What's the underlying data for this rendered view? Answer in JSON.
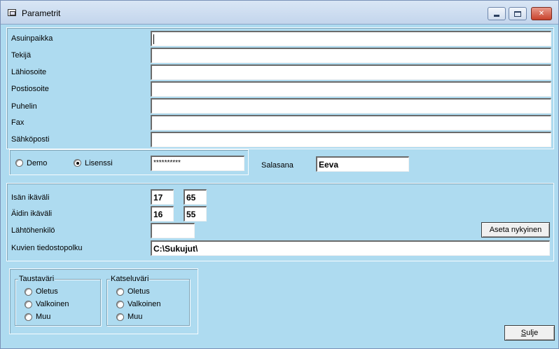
{
  "window": {
    "title": "Parametrit",
    "minimize_icon": "minimize-icon",
    "maximize_icon": "maximize-icon",
    "close_icon": "close-icon",
    "close_glyph": "✕"
  },
  "contact": {
    "fields": [
      {
        "label": "Asuinpaikka",
        "value": ""
      },
      {
        "label": "Tekijä",
        "value": ""
      },
      {
        "label": "Lähiosoite",
        "value": ""
      },
      {
        "label": "Postiosoite",
        "value": ""
      },
      {
        "label": "Puhelin",
        "value": ""
      },
      {
        "label": "Fax",
        "value": ""
      },
      {
        "label": "Sähköposti",
        "value": ""
      }
    ]
  },
  "license": {
    "demo_label": "Demo",
    "license_label": "Lisenssi",
    "selected": "Lisenssi",
    "license_key": "**********",
    "password_label": "Salasana",
    "password_value": "Eeva"
  },
  "ages": {
    "father_label": "Isän ikäväli",
    "father_min": "17",
    "father_max": "65",
    "mother_label": "Äidin ikäväli",
    "mother_min": "16",
    "mother_max": "55",
    "start_person_label": "Lähtöhenkilö",
    "start_person_value": "",
    "set_current_button": "Aseta nykyinen",
    "images_path_label": "Kuvien tiedostopolku",
    "images_path_value": "C:\\Sukujut\\"
  },
  "colors": {
    "background_group": "Taustaväri",
    "viewer_group": "Katseluväri",
    "options": [
      "Oletus",
      "Valkoinen",
      "Muu"
    ]
  },
  "footer": {
    "close_button_mnemonic": "S",
    "close_button_rest": "ulje"
  }
}
